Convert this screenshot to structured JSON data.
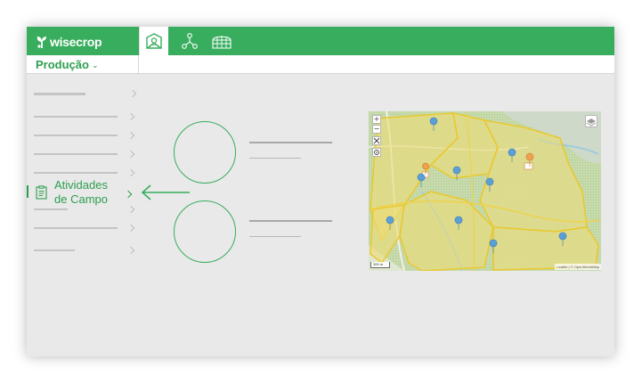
{
  "app": {
    "logo_text": "wisecrop",
    "brand_color": "#37ad5d",
    "tabs": [
      {
        "icon": "field-plot-icon",
        "active": true
      },
      {
        "icon": "network-nodes-icon",
        "active": false
      },
      {
        "icon": "greenhouse-icon",
        "active": false
      }
    ]
  },
  "header": {
    "module_label": "Produção",
    "module_chevron": "⌄"
  },
  "sidebar": {
    "active_item": {
      "label": "Atividades\nde Campo",
      "icon": "clipboard-list-icon"
    }
  },
  "map": {
    "zoom_in": "+",
    "zoom_out": "−",
    "scale_label": "300 m",
    "attribution": "Leaflet | © OpenStreetMap"
  }
}
